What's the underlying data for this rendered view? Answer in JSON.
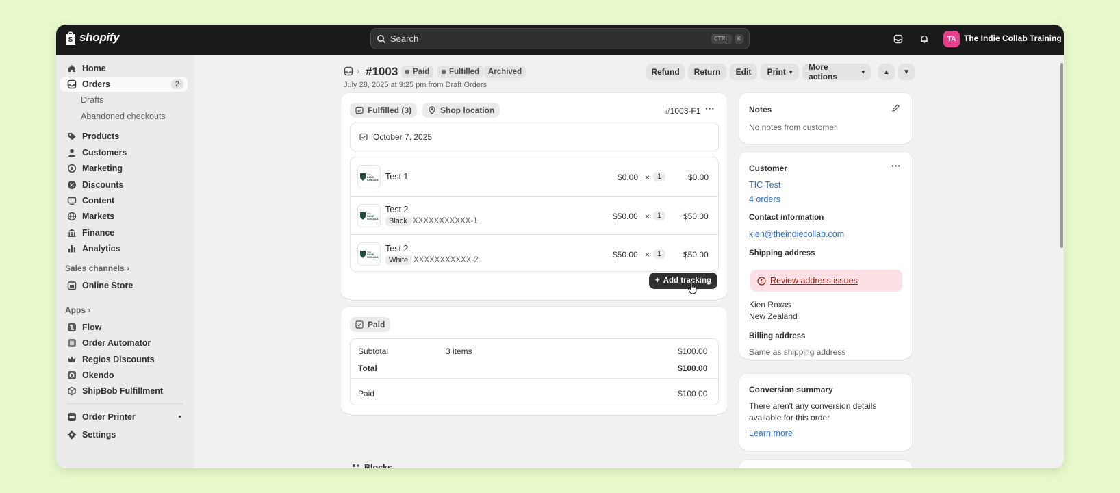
{
  "topbar": {
    "logo_text": "shopify",
    "search_placeholder": "Search",
    "shortcut_keys": [
      "CTRL",
      "K"
    ],
    "avatar_initials": "TA",
    "store_name": "The Indie Collab Training ..."
  },
  "sidebar": {
    "items": [
      {
        "label": "Home",
        "icon": "home-icon"
      },
      {
        "label": "Orders",
        "icon": "orders-icon",
        "badge": "2"
      },
      {
        "label": "Drafts"
      },
      {
        "label": "Abandoned checkouts"
      },
      {
        "label": "Products",
        "icon": "tag-icon"
      },
      {
        "label": "Customers",
        "icon": "person-icon"
      },
      {
        "label": "Marketing",
        "icon": "target-icon"
      },
      {
        "label": "Discounts",
        "icon": "discount-icon"
      },
      {
        "label": "Content",
        "icon": "content-icon"
      },
      {
        "label": "Markets",
        "icon": "globe-icon"
      },
      {
        "label": "Finance",
        "icon": "bank-icon"
      },
      {
        "label": "Analytics",
        "icon": "chart-icon"
      }
    ],
    "sales_channels_label": "Sales channels",
    "online_store": "Online Store",
    "apps_label": "Apps",
    "apps": [
      "Flow",
      "Order Automator",
      "Regios Discounts",
      "Okendo",
      "ShipBob Fulfillment"
    ],
    "order_printer": "Order Printer",
    "settings": "Settings"
  },
  "header": {
    "order_number": "#1003",
    "chips": [
      "Paid",
      "Fulfilled",
      "Archived"
    ],
    "subline": "July 28, 2025 at 9:25 pm from Draft Orders",
    "buttons": [
      "Refund",
      "Return",
      "Edit",
      "Print",
      "More actions"
    ]
  },
  "fulfillment": {
    "status_pill": "Fulfilled (3)",
    "location_pill": "Shop location",
    "fulfillment_id": "#1003-F1",
    "date": "October 7, 2025",
    "items": [
      {
        "name": "Test 1",
        "variant": "",
        "sku": "",
        "price": "$0.00",
        "qty": "1",
        "total": "$0.00"
      },
      {
        "name": "Test 2",
        "variant": "Black",
        "sku": "XXXXXXXXXXX-1",
        "price": "$50.00",
        "qty": "1",
        "total": "$50.00"
      },
      {
        "name": "Test 2",
        "variant": "White",
        "sku": "XXXXXXXXXXX-2",
        "price": "$50.00",
        "qty": "1",
        "total": "$50.00"
      }
    ],
    "times_sign": "×",
    "logo_text": [
      "THE",
      "INDIE",
      "COLLAB"
    ],
    "add_tracking": "Add tracking"
  },
  "payment": {
    "status_pill": "Paid",
    "subtotal_label": "Subtotal",
    "subtotal_items": "3 items",
    "subtotal_value": "$100.00",
    "total_label": "Total",
    "total_value": "$100.00",
    "paid_label": "Paid",
    "paid_value": "$100.00"
  },
  "blocks_label": "Blocks",
  "notes": {
    "title": "Notes",
    "text": "No notes from customer"
  },
  "customer": {
    "title": "Customer",
    "name": "TIC Test",
    "orders": "4 orders",
    "contact_label": "Contact information",
    "email": "kien@theindiecollab.com",
    "shipping_label": "Shipping address",
    "warning": "Review address issues",
    "address_line1": "Kien Roxas",
    "address_line2": "New Zealand",
    "billing_label": "Billing address",
    "billing_text": "Same as shipping address"
  },
  "conversion": {
    "title": "Conversion summary",
    "text_line1": "There aren't any conversion details",
    "text_line2": "available for this order",
    "link": "Learn more"
  }
}
